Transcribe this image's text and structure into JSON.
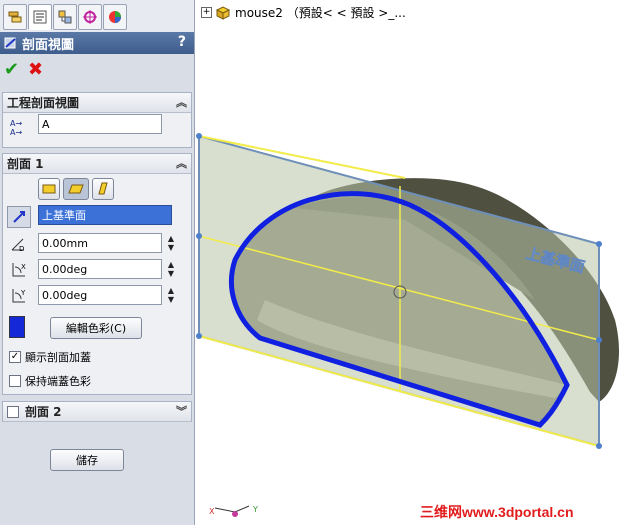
{
  "tabs": [
    {
      "icon": "feature-tree-icon"
    },
    {
      "icon": "property-manager-icon"
    },
    {
      "icon": "configuration-icon"
    },
    {
      "icon": "dimxpert-icon"
    },
    {
      "icon": "display-manager-icon"
    }
  ],
  "panel": {
    "title": "剖面視圖",
    "help": "?"
  },
  "actions": {
    "ok": "✔",
    "cancel": "✖"
  },
  "group1": {
    "title": "工程剖面視圖",
    "name_value": "A"
  },
  "group2": {
    "title": "剖面 1",
    "plane": "上基準面",
    "offset": "0.00mm",
    "rot_x": "0.00deg",
    "rot_y": "0.00deg",
    "color_button": "編輯色彩(C)",
    "swatch_color": "#1428d8",
    "show_cap": "顯示剖面加蓋",
    "show_cap_checked": true,
    "keep_color": "保持端蓋色彩",
    "keep_color_checked": false
  },
  "group3": {
    "title": "剖面 2",
    "checked": false
  },
  "save_button": "儲存",
  "tree": {
    "label": "mouse2 （預設< < 預設 >_..."
  },
  "viewport": {
    "plane_label": "上基準面",
    "triad_x": "X",
    "triad_y": "Y"
  },
  "watermark": "三维网www.3dportal.cn"
}
